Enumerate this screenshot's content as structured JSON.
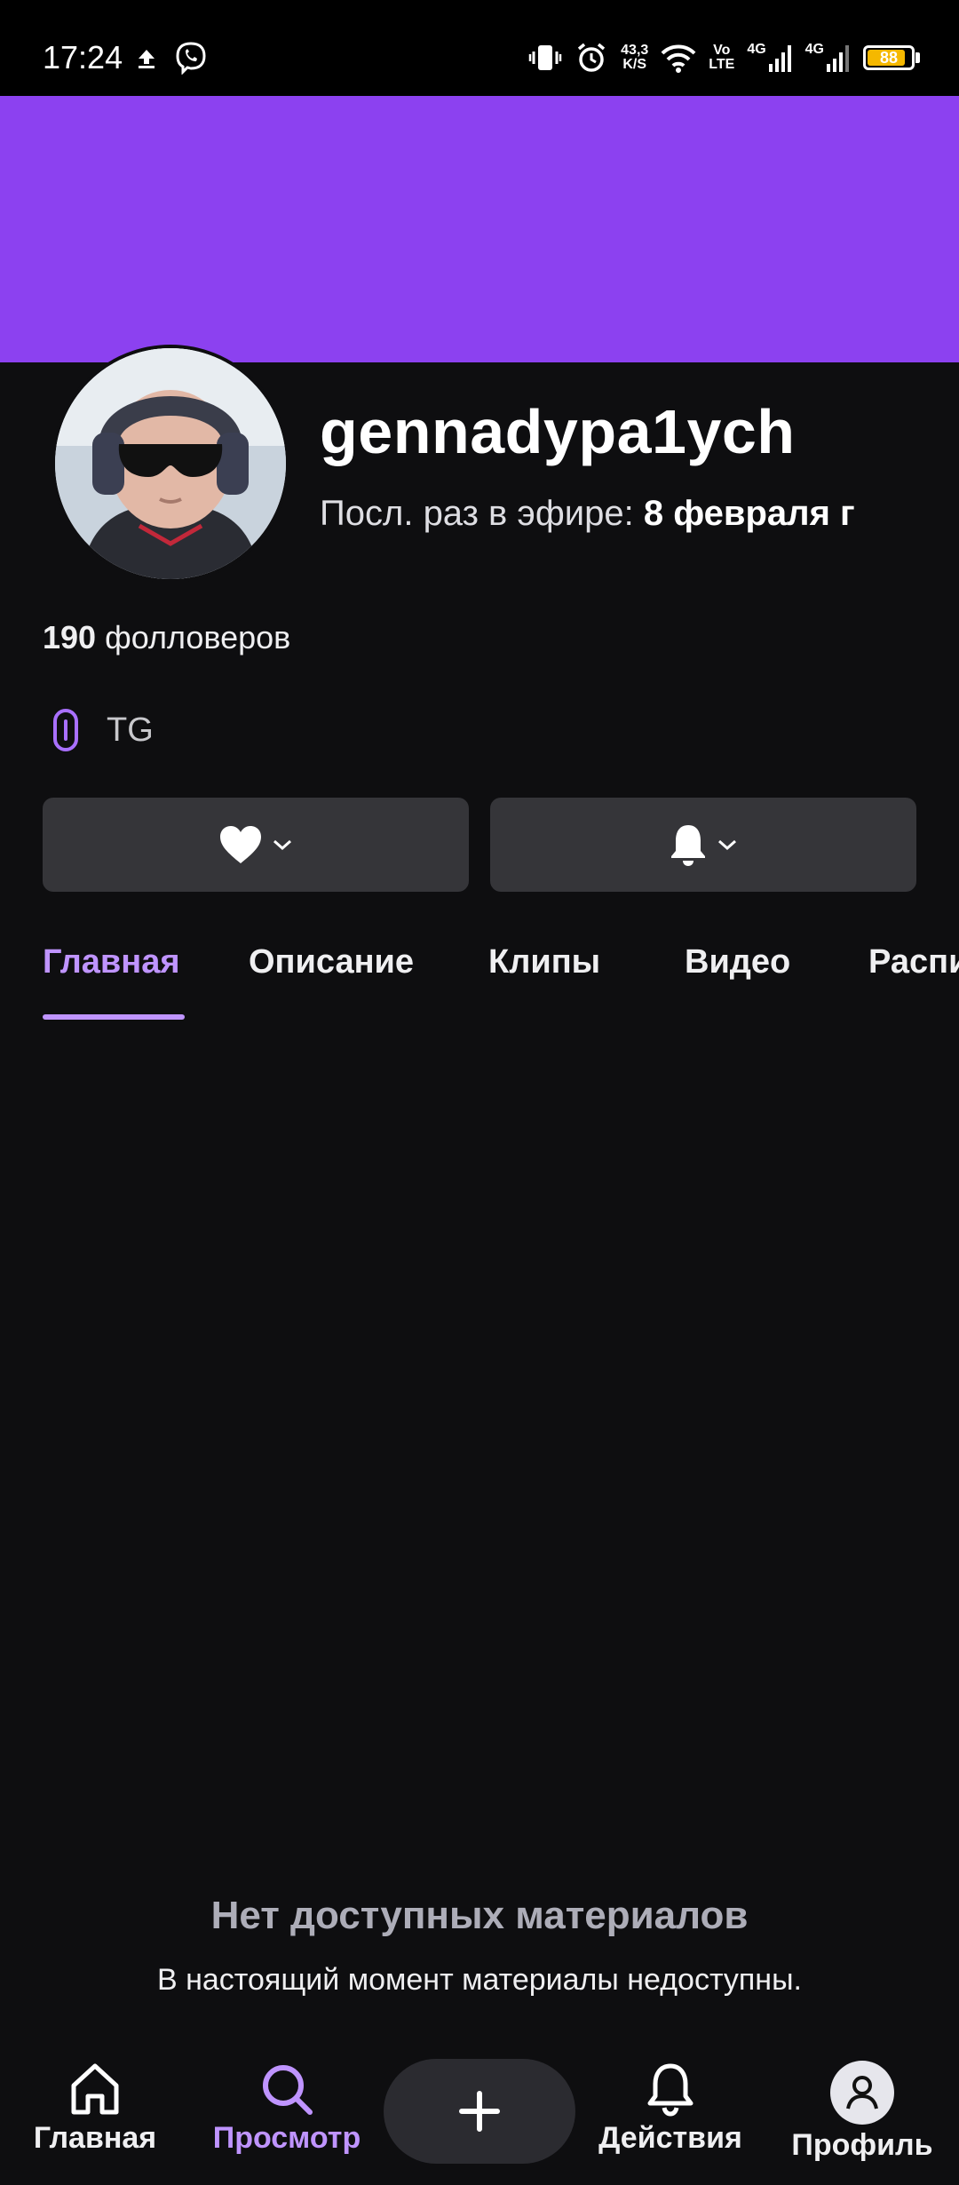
{
  "status_bar": {
    "time": "17:24",
    "net_speed_value": "43,3",
    "net_speed_unit": "K/S",
    "volte_top": "Vo",
    "volte_bottom": "LTE",
    "sim1_label": "4G",
    "sim2_label": "4G",
    "battery_level": "88",
    "battery_fraction": 0.88,
    "battery_color": "#f5b800"
  },
  "profile": {
    "banner_color": "#8c41f0",
    "username": "gennadypa1ych",
    "last_live_prefix": "Посл. раз в эфире:",
    "last_live_date": "8 февраля  г",
    "followers_count": "190",
    "followers_label": "фолловеров",
    "link_label": "TG"
  },
  "tabs": [
    {
      "label": "Главная",
      "active": true
    },
    {
      "label": "Описание",
      "active": false
    },
    {
      "label": "Клипы",
      "active": false
    },
    {
      "label": "Видео",
      "active": false
    },
    {
      "label": "Распи",
      "active": false
    }
  ],
  "empty_state": {
    "title": "Нет доступных материалов",
    "subtitle": "В настоящий момент материалы недоступны."
  },
  "bottom_nav": {
    "home": "Главная",
    "browse": "Просмотр",
    "activity": "Действия",
    "profile": "Профиль"
  },
  "colors": {
    "accent": "#bf94ff",
    "background": "#0e0e10",
    "button_bg": "#353539"
  },
  "icons": {
    "follow": "heart-icon",
    "notify": "bell-icon",
    "link": "link-icon",
    "create": "plus-icon"
  }
}
